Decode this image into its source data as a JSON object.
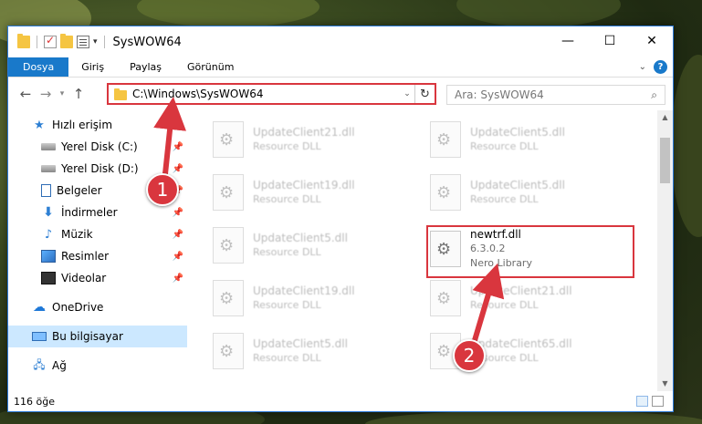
{
  "window": {
    "title": "SysWOW64",
    "minimize_label": "—",
    "maximize_label": "☐",
    "close_label": "✕"
  },
  "ribbon": {
    "tabs": [
      "Dosya",
      "Giriş",
      "Paylaş",
      "Görünüm"
    ]
  },
  "address": {
    "path": "C:\\Windows\\SysWOW64"
  },
  "search": {
    "placeholder": "Ara: SysWOW64"
  },
  "sidebar": {
    "items": [
      {
        "label": "Hızlı erişim",
        "icon": "star-icon"
      },
      {
        "label": "Yerel Disk (C:)",
        "icon": "disk-icon",
        "pinned": true
      },
      {
        "label": "Yerel Disk (D:)",
        "icon": "disk-icon",
        "pinned": true
      },
      {
        "label": "Belgeler",
        "icon": "document-icon",
        "pinned": true
      },
      {
        "label": "İndirmeler",
        "icon": "download-icon",
        "pinned": true
      },
      {
        "label": "Müzik",
        "icon": "music-icon",
        "pinned": true
      },
      {
        "label": "Resimler",
        "icon": "pictures-icon",
        "pinned": true
      },
      {
        "label": "Videolar",
        "icon": "video-icon",
        "pinned": true
      },
      {
        "label": "OneDrive",
        "icon": "cloud-icon"
      },
      {
        "label": "Bu bilgisayar",
        "icon": "computer-icon",
        "selected": true
      },
      {
        "label": "Ağ",
        "icon": "network-icon"
      }
    ],
    "pin_glyph": "📌"
  },
  "files": [
    {
      "name": "UpdateClient21.dll",
      "line1": "Resource DLL",
      "line2": ""
    },
    {
      "name": "UpdateClient5.dll",
      "line1": "Resource DLL",
      "line2": ""
    },
    {
      "name": "UpdateClient19.dll",
      "line1": "Resource DLL",
      "line2": ""
    },
    {
      "name": "UpdateClient5.dll",
      "line1": "Resource DLL",
      "line2": ""
    },
    {
      "name": "UpdateClient5.dll",
      "line1": "Resource DLL",
      "line2": ""
    },
    {
      "name": "newtrf.dll",
      "line1": "6.3.0.2",
      "line2": "Nero Library"
    },
    {
      "name": "UpdateClient19.dll",
      "line1": "Resource DLL",
      "line2": ""
    },
    {
      "name": "UpdateClient21.dll",
      "line1": "Resource DLL",
      "line2": ""
    },
    {
      "name": "UpdateClient5.dll",
      "line1": "Resource DLL",
      "line2": ""
    },
    {
      "name": "UpdateClient65.dll",
      "line1": "Resource DLL",
      "line2": ""
    }
  ],
  "status": {
    "count": "116 öğe"
  },
  "callouts": {
    "one": "1",
    "two": "2"
  },
  "colors": {
    "accent": "#1979ca",
    "highlight": "#d9363e"
  }
}
